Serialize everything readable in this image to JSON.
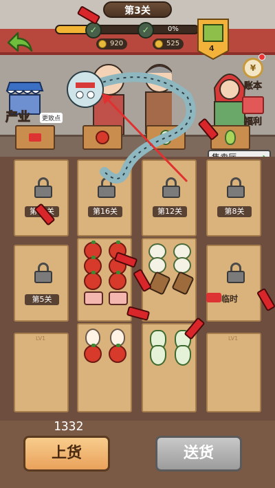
{
  "header": {
    "stage": "第3关",
    "progress_fraction": 0.3,
    "progress_percent": "0%",
    "coins": "920",
    "ingots": "525",
    "gift_count": "4"
  },
  "left_menu": {
    "industry_label": "产业",
    "industry_note": "更致点"
  },
  "right_menu": {
    "account_label": "账本",
    "welfare_label": "福利"
  },
  "sell_hall": {
    "label": "售卖厅"
  },
  "shelf": {
    "locks": [
      {
        "label": "第20关"
      },
      {
        "label": "第16关"
      },
      {
        "label": "第12关"
      },
      {
        "label": "第8关"
      },
      {
        "label": "第5关"
      }
    ],
    "temp_label": "临时",
    "empty_labels": [
      "LV1",
      "LV1"
    ]
  },
  "footer": {
    "count": "1332",
    "load_label": "上货",
    "send_label": "送货"
  },
  "colors": {
    "accent": "#f2b435",
    "load_button": "#e9a25c",
    "send_button": "#9c9c9c"
  }
}
